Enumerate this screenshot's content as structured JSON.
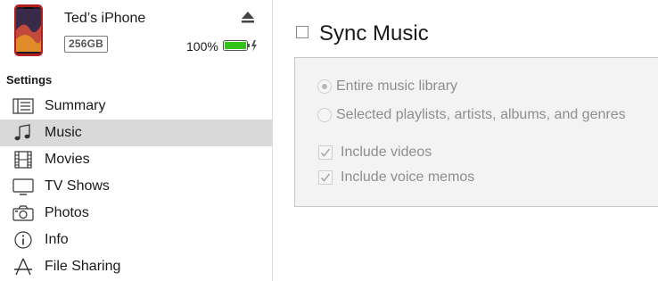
{
  "device": {
    "name": "Ted’s iPhone",
    "capacity": "256GB",
    "battery_percent": "100%",
    "battery_level": 1.0,
    "battery_color": "#33c41a"
  },
  "sidebar": {
    "heading": "Settings",
    "selected_color": "#d9d9d9",
    "items": [
      {
        "label": "Summary",
        "icon": "summary-list-icon"
      },
      {
        "label": "Music",
        "icon": "music-note-icon"
      },
      {
        "label": "Movies",
        "icon": "film-strip-icon"
      },
      {
        "label": "TV Shows",
        "icon": "tv-icon"
      },
      {
        "label": "Photos",
        "icon": "camera-icon"
      },
      {
        "label": "Info",
        "icon": "info-icon"
      },
      {
        "label": "File Sharing",
        "icon": "file-sharing-icon"
      }
    ]
  },
  "main": {
    "sync_title": "Sync Music",
    "sync_checked": false,
    "options": {
      "entire_library": "Entire music library",
      "selected_items": "Selected playlists, artists, albums, and genres",
      "include_videos": "Include videos",
      "include_voice_memos": "Include voice memos"
    }
  }
}
